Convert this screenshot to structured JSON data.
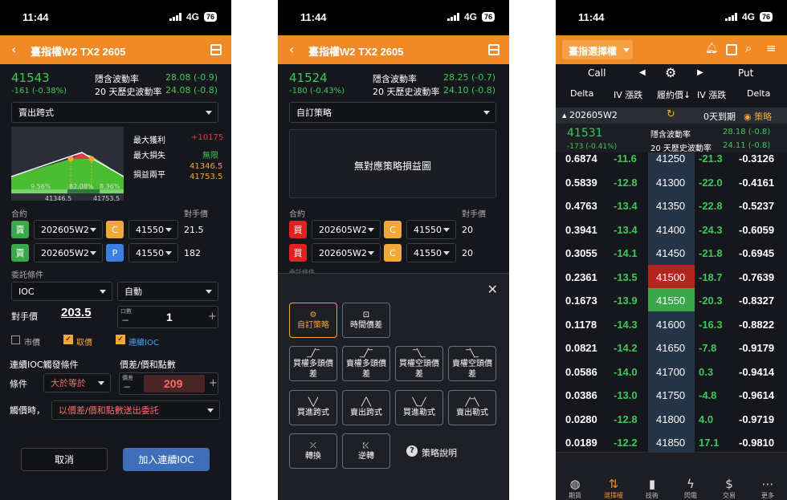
{
  "status": {
    "time": "11:44",
    "network": "4G",
    "battery": "76"
  },
  "p1": {
    "title": "臺指權W2 TX2 2605",
    "price": "41543",
    "change": "-161 (-0.38%)",
    "iv_label": "隱含波動率",
    "iv": "28.08 (-0.9)",
    "hv_label": "20 天歷史波動率",
    "hv": "24.08 (-0.8)",
    "strategy": "賣出跨式",
    "max_profit_label": "最大獲利",
    "max_profit": "+10175",
    "max_loss_label": "最大損失",
    "max_loss": "無限",
    "breakeven_label": "損益兩平",
    "breakeven1": "41346.5",
    "breakeven2": "41753.5",
    "prob1": "9.56%",
    "prob2": "82.08%",
    "prob3": "8.36%",
    "axis1": "41346.5",
    "axis2": "41753.5",
    "contract_label": "合約",
    "opp_label": "對手價",
    "legs": [
      {
        "side": "賣",
        "month": "202605W2",
        "cp": "C",
        "strike": "41550",
        "price": "21.5"
      },
      {
        "side": "賣",
        "month": "202605W2",
        "cp": "P",
        "strike": "41550",
        "price": "182"
      }
    ],
    "cond_label": "委託條件",
    "cond_type": "IOC",
    "cond_mode": "自動",
    "opp_price_label": "對手價",
    "opp_price_value": "203.5",
    "lot_label": "口數",
    "lot": "1",
    "cb_market": "市價",
    "cb_take": "取價",
    "cb_ioc": "連續IOC",
    "trigger_label": "連續IOC觸發條件",
    "diff_label": "價差/價和點數",
    "condition_label": "條件",
    "condition": "大於等於",
    "diff_small": "價差",
    "diff_value": "209",
    "trigger_when": "觸價時，",
    "trigger_action": "以價差/價和點數送出委託",
    "cancel": "取消",
    "confirm": "加入連續IOC"
  },
  "p2": {
    "title": "臺指權W2 TX2 2605",
    "price": "41524",
    "change": "-180 (-0.43%)",
    "iv_label": "隱含波動率",
    "iv": "28.25 (-0.7)",
    "hv_label": "20 天歷史波動率",
    "hv": "24.10 (-0.8)",
    "strategy": "自訂策略",
    "no_chart": "無對應策略損益圖",
    "contract_label": "合約",
    "opp_label": "對手價",
    "legs": [
      {
        "side": "買",
        "month": "202605W2",
        "cp": "C",
        "strike": "41550",
        "price": "20"
      },
      {
        "side": "買",
        "month": "202605W2",
        "cp": "C",
        "strike": "41550",
        "price": "20"
      }
    ],
    "cut_label": "委託條件",
    "strategies": [
      "自訂策略",
      "時間價差",
      "買權多頭價差",
      "賣權多頭價差",
      "買權空頭價差",
      "賣權空頭價差",
      "買進跨式",
      "賣出跨式",
      "買進勒式",
      "賣出勒式",
      "轉換",
      "逆轉"
    ],
    "help": "策略說明"
  },
  "p3": {
    "title": "臺指選擇權",
    "call": "Call",
    "put": "Put",
    "cols": [
      "Delta",
      "IV 漲跌",
      "履約價↓",
      "IV 漲跌",
      "Delta"
    ],
    "month": "202605W2",
    "expiry": "0天到期",
    "strategy": "策略",
    "price": "41531",
    "change": "-173 (-0.41%)",
    "iv_label": "隱含波動率",
    "iv": "28.18 (-0.8)",
    "hv_label": "20 天歷史波動率",
    "hv": "24.11 (-0.8)",
    "rows": [
      [
        "0.6874",
        "-11.6",
        "41250",
        "-21.3",
        "-0.3126"
      ],
      [
        "0.5839",
        "-12.8",
        "41300",
        "-22.0",
        "-0.4161"
      ],
      [
        "0.4763",
        "-13.4",
        "41350",
        "-22.8",
        "-0.5237"
      ],
      [
        "0.3941",
        "-13.4",
        "41400",
        "-24.3",
        "-0.6059"
      ],
      [
        "0.3055",
        "-14.1",
        "41450",
        "-21.8",
        "-0.6945"
      ],
      [
        "0.2361",
        "-13.5",
        "41500",
        "-18.7",
        "-0.7639"
      ],
      [
        "0.1673",
        "-13.9",
        "41550",
        "-20.3",
        "-0.8327"
      ],
      [
        "0.1178",
        "-14.3",
        "41600",
        "-16.3",
        "-0.8822"
      ],
      [
        "0.0821",
        "-14.2",
        "41650",
        "-7.8",
        "-0.9179"
      ],
      [
        "0.0586",
        "-14.0",
        "41700",
        "0.3",
        "-0.9414"
      ],
      [
        "0.0386",
        "-13.0",
        "41750",
        "-4.8",
        "-0.9614"
      ],
      [
        "0.0280",
        "-12.8",
        "41800",
        "4.0",
        "-0.9719"
      ],
      [
        "0.0189",
        "-12.2",
        "41850",
        "17.1",
        "-0.9810"
      ]
    ],
    "tabs": [
      "期貨",
      "選擇權",
      "技術",
      "閃電",
      "交易",
      "更多"
    ]
  },
  "colors": {
    "accent": "#ef8a26",
    "up": "#3ec85a",
    "down": "#e23a3a",
    "bg": "#15171c"
  }
}
